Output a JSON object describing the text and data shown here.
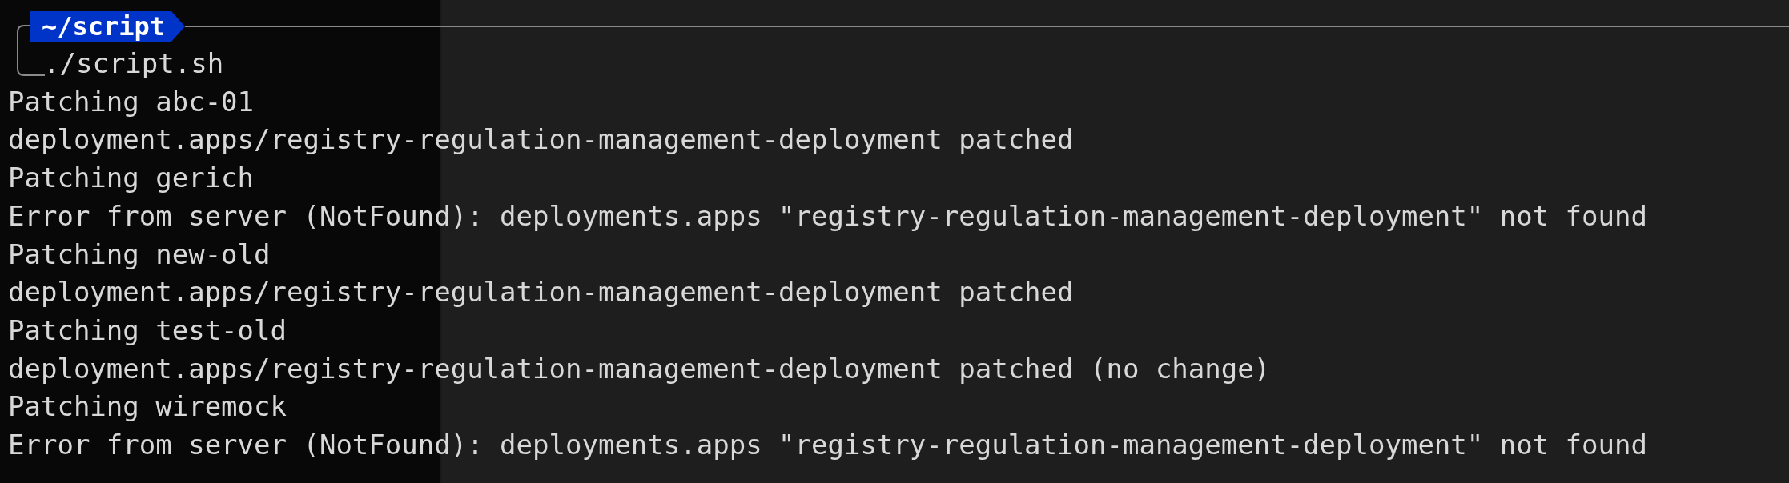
{
  "terminal": {
    "prompt": {
      "path": "~/script",
      "command": "./script.sh"
    },
    "lines": [
      "Patching abc-01",
      "deployment.apps/registry-regulation-management-deployment patched",
      "Patching gerich",
      "Error from server (NotFound): deployments.apps \"registry-regulation-management-deployment\" not found",
      "Patching new-old",
      "deployment.apps/registry-regulation-management-deployment patched",
      "Patching test-old",
      "deployment.apps/registry-regulation-management-deployment patched (no change)",
      "Patching wiremock",
      "Error from server (NotFound): deployments.apps \"registry-regulation-management-deployment\" not found"
    ]
  }
}
